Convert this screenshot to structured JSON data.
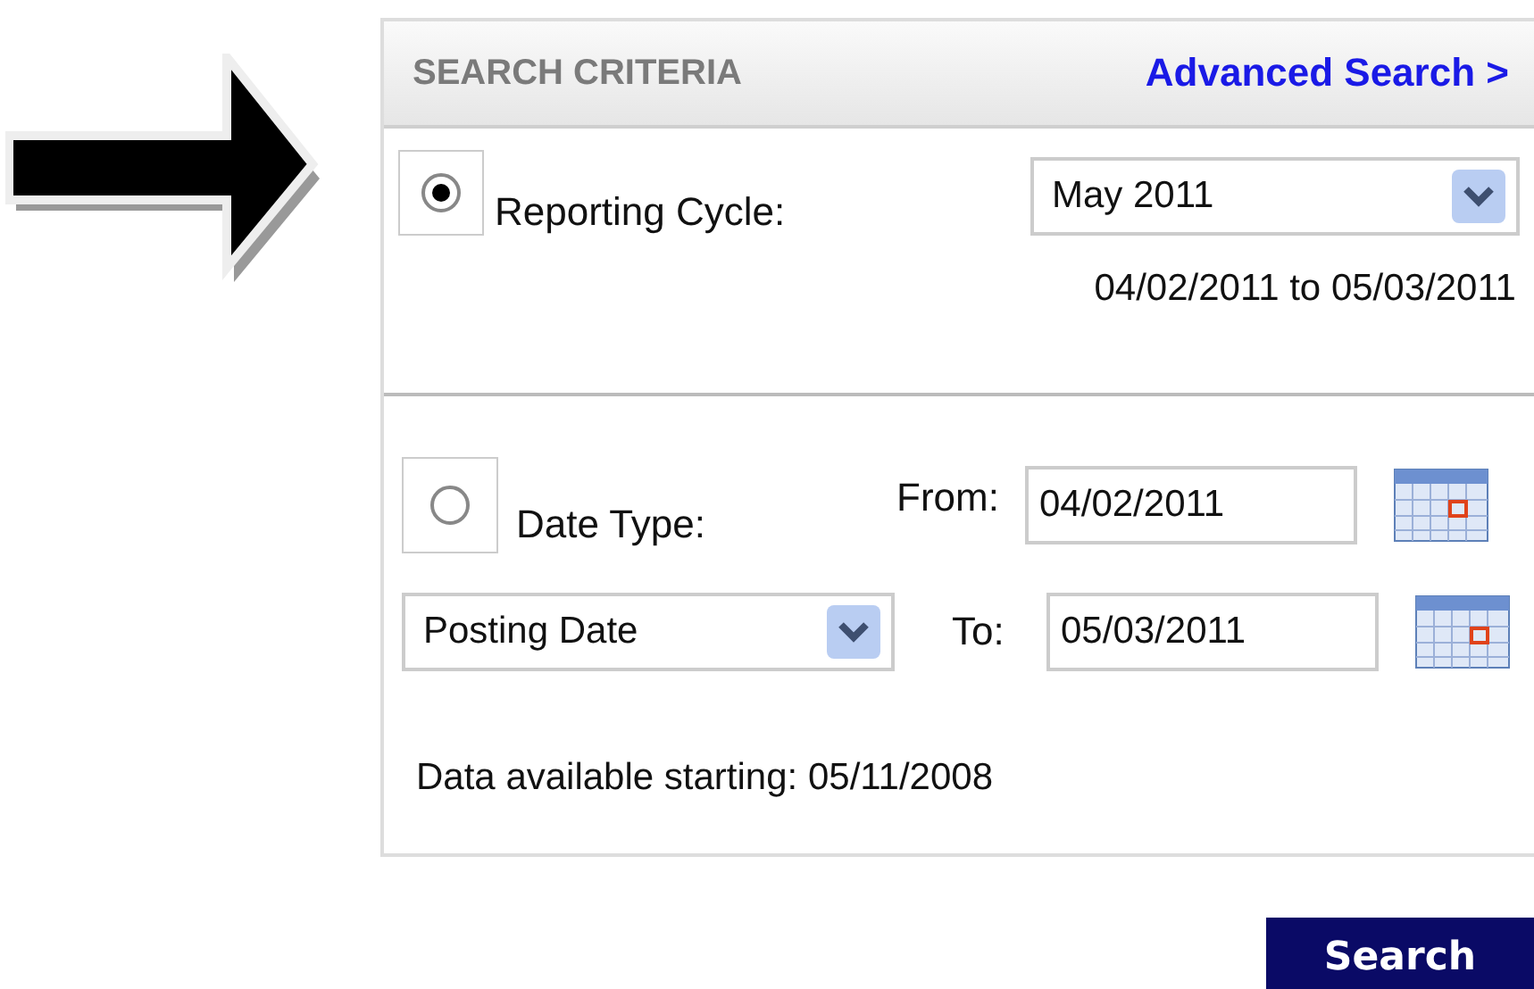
{
  "header": {
    "title": "SEARCH CRITERIA",
    "link": "Advanced Search >"
  },
  "reporting_cycle": {
    "selected": true,
    "label": "Reporting Cycle:",
    "dropdown": {
      "value": "May 2011"
    },
    "range": "04/02/2011 to 05/03/2011"
  },
  "date_type": {
    "selected": false,
    "label": "Date Type:",
    "dropdown": {
      "value": "Posting Date"
    },
    "from": {
      "label": "From:",
      "value": "04/02/2011"
    },
    "to": {
      "label": "To:",
      "value": "05/03/2011"
    },
    "note": "Data available starting: 05/11/2008"
  },
  "buttons": [
    "Search"
  ]
}
